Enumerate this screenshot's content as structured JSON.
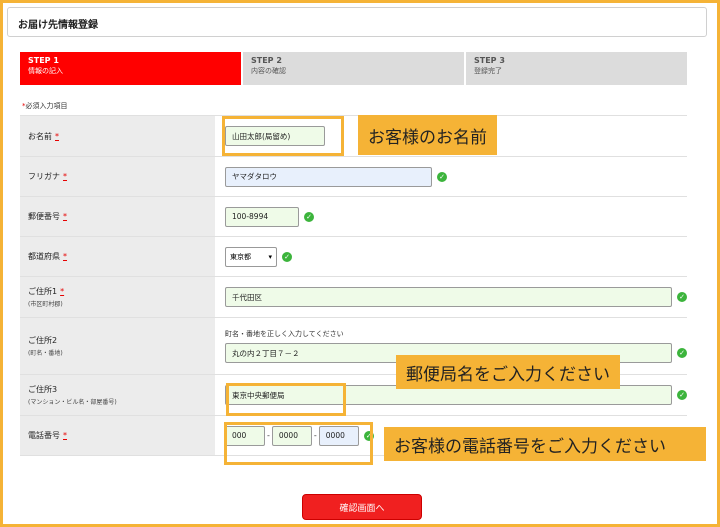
{
  "header": {
    "title": "お届け先情報登録"
  },
  "steps": [
    {
      "title": "STEP 1",
      "sub": "情報の記入"
    },
    {
      "title": "STEP 2",
      "sub": "内容の確認"
    },
    {
      "title": "STEP 3",
      "sub": "登録完了"
    }
  ],
  "required_note": {
    "mark": "*",
    "text": "必須入力項目"
  },
  "required_mark": "*",
  "form": {
    "name": {
      "label": "お名前",
      "value": "山田太郎(局留め)"
    },
    "kana": {
      "label": "フリガナ",
      "value": "ヤマダタロウ"
    },
    "postal": {
      "label": "郵便番号",
      "value": "100-8994"
    },
    "prefecture": {
      "label": "都道府県",
      "value": "東京都",
      "arrow": "▾"
    },
    "address1": {
      "label": "ご住所1",
      "sub": "(市区町村郡)",
      "value": "千代田区"
    },
    "address2": {
      "label": "ご住所2",
      "sub": "(町名・番地)",
      "hint": "町名・番地を正しく入力してください",
      "value": "丸の内２丁目７－２"
    },
    "address3": {
      "label": "ご住所3",
      "sub": "(マンション・ビル名・部屋番号)",
      "value": "東京中央郵便局"
    },
    "phone": {
      "label": "電話番号",
      "parts": [
        "000",
        "0000",
        "0000"
      ],
      "separator": "-"
    }
  },
  "callouts": {
    "name": "お客様のお名前",
    "post_office": "郵便局名をご入力ください",
    "phone": "お客様の電話番号をご入力ください"
  },
  "submit": {
    "label": "確認画面へ"
  },
  "colors": {
    "accent": "#ff0000",
    "highlight": "#f5b336",
    "ok": "#3cb43c"
  },
  "icons": {
    "valid": "check-circle-icon"
  }
}
